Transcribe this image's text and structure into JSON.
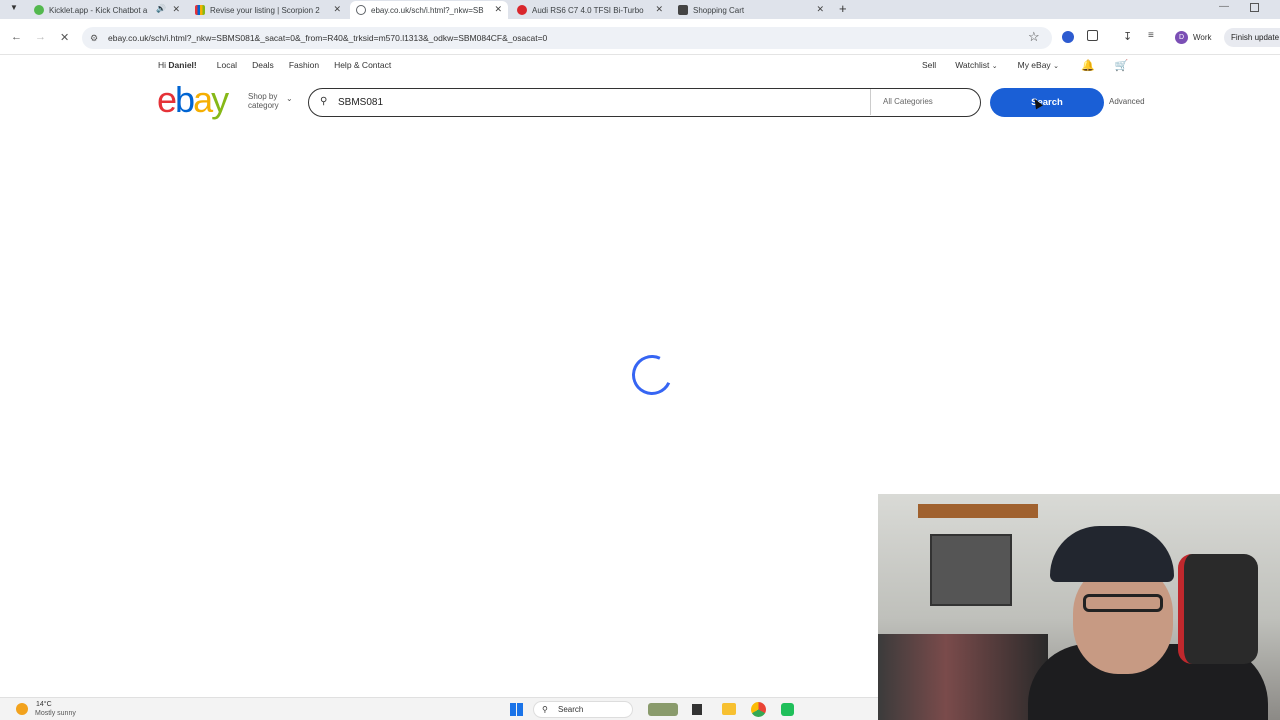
{
  "browser": {
    "tabs": [
      {
        "title": "Kicklet.app - Kick Chatbot a",
        "color": "#53b84e"
      },
      {
        "title": "Revise your listing | Scorpion 2",
        "color": "#e53238"
      },
      {
        "title": "ebay.co.uk/sch/i.html?_nkw=SB",
        "color": "#5f6368"
      },
      {
        "title": "Audi RS6 C7 4.0 TFSI Bi-Turbo",
        "color": "#d9262c"
      },
      {
        "title": "Shopping Cart",
        "color": "#444444"
      }
    ],
    "url": "ebay.co.uk/sch/i.html?_nkw=SBMS081&_sacat=0&_from=R40&_trksid=m570.l1313&_odkw=SBM084CF&_osacat=0",
    "profile_initial": "D",
    "profile_label": "Work",
    "update_label": "Finish update"
  },
  "ebay": {
    "greeting": "Hi",
    "user_name": "Daniel!",
    "top_links": [
      "Local",
      "Deals",
      "Fashion",
      "Help & Contact"
    ],
    "right_links": {
      "sell": "Sell",
      "watchlist": "Watchlist",
      "my_ebay": "My eBay"
    },
    "logo_letters": [
      "e",
      "b",
      "a",
      "y"
    ],
    "logo_colors": [
      "#e53238",
      "#0064d2",
      "#f5af02",
      "#86b817"
    ],
    "shop_by_category": "Shop by category",
    "search_value": "SBMS081",
    "category": "All Categories",
    "search_button": "Search",
    "advanced": "Advanced"
  },
  "taskbar": {
    "temperature": "14°C",
    "weather": "Mostly sunny",
    "search_label": "Search"
  }
}
